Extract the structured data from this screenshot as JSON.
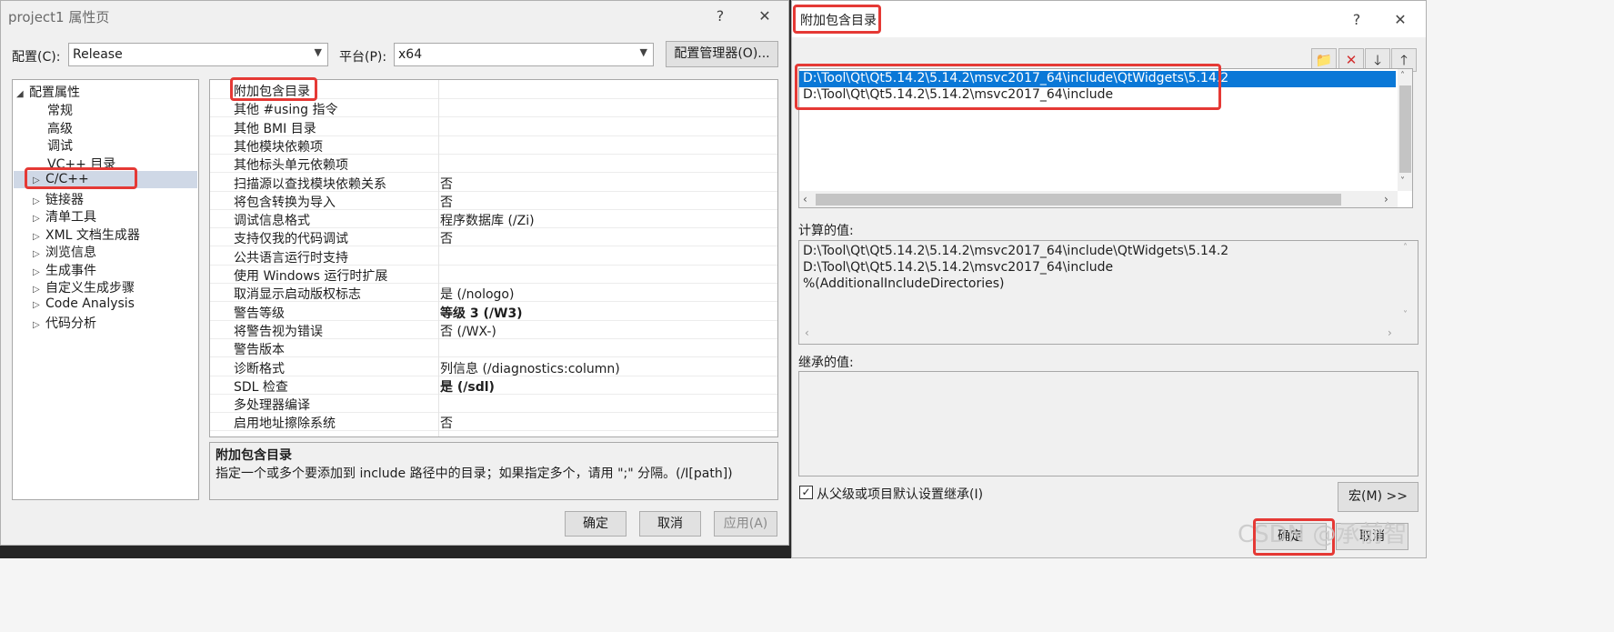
{
  "left_dialog": {
    "title": "project1 属性页",
    "help": "?",
    "close": "✕",
    "config_label": "配置(C):",
    "config_value": "Release",
    "platform_label": "平台(P):",
    "platform_value": "x64",
    "config_manager": "配置管理器(O)...",
    "tree": {
      "root": "配置属性",
      "items": [
        {
          "label": "常规",
          "expandable": false
        },
        {
          "label": "高级",
          "expandable": false
        },
        {
          "label": "调试",
          "expandable": false
        },
        {
          "label": "VC++ 目录",
          "expandable": false
        },
        {
          "label": "C/C++",
          "expandable": true,
          "selected": true
        },
        {
          "label": "链接器",
          "expandable": true
        },
        {
          "label": "清单工具",
          "expandable": true
        },
        {
          "label": "XML 文档生成器",
          "expandable": true
        },
        {
          "label": "浏览信息",
          "expandable": true
        },
        {
          "label": "生成事件",
          "expandable": true
        },
        {
          "label": "自定义生成步骤",
          "expandable": true
        },
        {
          "label": "Code Analysis",
          "expandable": true
        },
        {
          "label": "代码分析",
          "expandable": true
        }
      ]
    },
    "properties": [
      {
        "name": "附加包含目录",
        "value": ""
      },
      {
        "name": "其他 #using 指令",
        "value": ""
      },
      {
        "name": "其他 BMI 目录",
        "value": ""
      },
      {
        "name": "其他模块依赖项",
        "value": ""
      },
      {
        "name": "其他标头单元依赖项",
        "value": ""
      },
      {
        "name": "扫描源以查找模块依赖关系",
        "value": "否"
      },
      {
        "name": "将包含转换为导入",
        "value": "否"
      },
      {
        "name": "调试信息格式",
        "value": "程序数据库 (/Zi)"
      },
      {
        "name": "支持仅我的代码调试",
        "value": "否"
      },
      {
        "name": "公共语言运行时支持",
        "value": ""
      },
      {
        "name": "使用 Windows 运行时扩展",
        "value": ""
      },
      {
        "name": "取消显示启动版权标志",
        "value": "是 (/nologo)"
      },
      {
        "name": "警告等级",
        "value": "等级 3 (/W3)",
        "bold": true
      },
      {
        "name": "将警告视为错误",
        "value": "否 (/WX-)"
      },
      {
        "name": "警告版本",
        "value": ""
      },
      {
        "name": "诊断格式",
        "value": "列信息 (/diagnostics:column)"
      },
      {
        "name": "SDL 检查",
        "value": "是 (/sdl)",
        "bold": true
      },
      {
        "name": "多处理器编译",
        "value": ""
      },
      {
        "name": "启用地址擦除系统",
        "value": "否"
      }
    ],
    "desc_title": "附加包含目录",
    "desc_text": "指定一个或多个要添加到 include 路径中的目录；如果指定多个，请用 \";\" 分隔。(/I[path])",
    "ok": "确定",
    "cancel": "取消",
    "apply": "应用(A)"
  },
  "right_dialog": {
    "title": "附加包含目录",
    "help": "?",
    "close": "✕",
    "toolbar_icons": [
      "new-folder-icon",
      "delete-icon",
      "move-down-icon",
      "move-up-icon"
    ],
    "toolbar_glyphs": [
      "📁",
      "✕",
      "🡓",
      "🡑"
    ],
    "entries": [
      "D:\\Tool\\Qt\\Qt5.14.2\\5.14.2\\msvc2017_64\\include\\QtWidgets\\5.14.2",
      "D:\\Tool\\Qt\\Qt5.14.2\\5.14.2\\msvc2017_64\\include"
    ],
    "computed_label": "计算的值:",
    "computed": [
      "D:\\Tool\\Qt\\Qt5.14.2\\5.14.2\\msvc2017_64\\include\\QtWidgets\\5.14.2",
      "D:\\Tool\\Qt\\Qt5.14.2\\5.14.2\\msvc2017_64\\include",
      "%(AdditionalIncludeDirectories)"
    ],
    "inherited_label": "继承的值:",
    "inherit_checkbox": "从父级或项目默认设置继承(I)",
    "macro": "宏(M) >>",
    "ok": "确定",
    "cancel": "取消"
  },
  "watermark": "CSDN @承前智",
  "colors": {
    "highlight": "#e53935",
    "selection": "#0a78d7",
    "tree_selected": "#cfd8e6"
  }
}
